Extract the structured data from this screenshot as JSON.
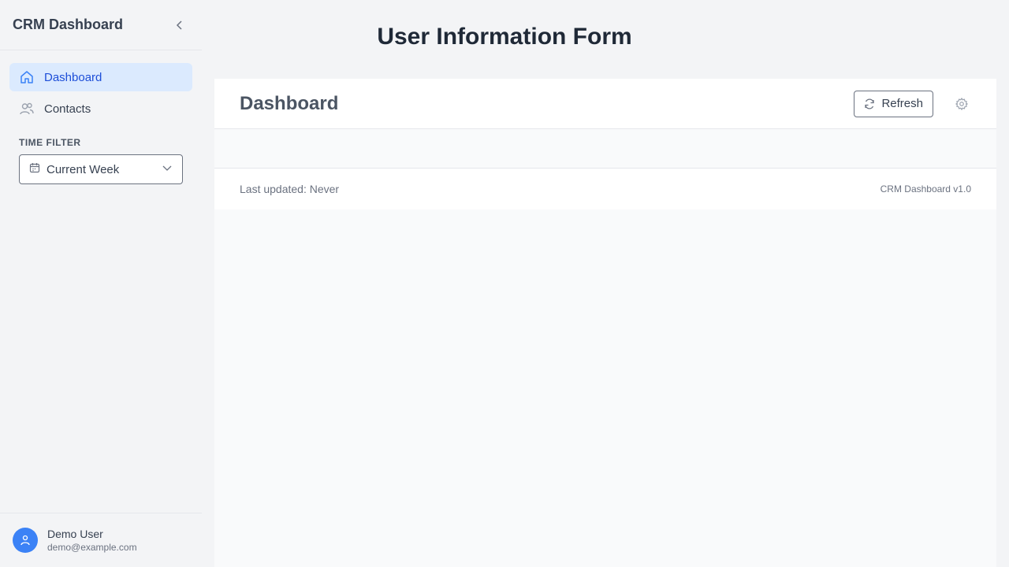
{
  "page": {
    "title": "User Information Form"
  },
  "sidebar": {
    "title": "CRM Dashboard",
    "items": [
      {
        "label": "Dashboard",
        "icon": "home-icon",
        "active": true
      },
      {
        "label": "Contacts",
        "icon": "users-icon",
        "active": false
      }
    ],
    "time_filter": {
      "label": "TIME FILTER",
      "value": "Current Week",
      "icon": "calendar-icon"
    },
    "user": {
      "name": "Demo User",
      "email": "demo@example.com"
    }
  },
  "main": {
    "title": "Dashboard",
    "refresh_label": "Refresh",
    "last_updated": "Last updated: Never",
    "version": "CRM Dashboard v1.0"
  },
  "colors": {
    "accent": "#3b82f6",
    "active_bg": "#dbeafe",
    "active_text": "#1d4ed8"
  }
}
